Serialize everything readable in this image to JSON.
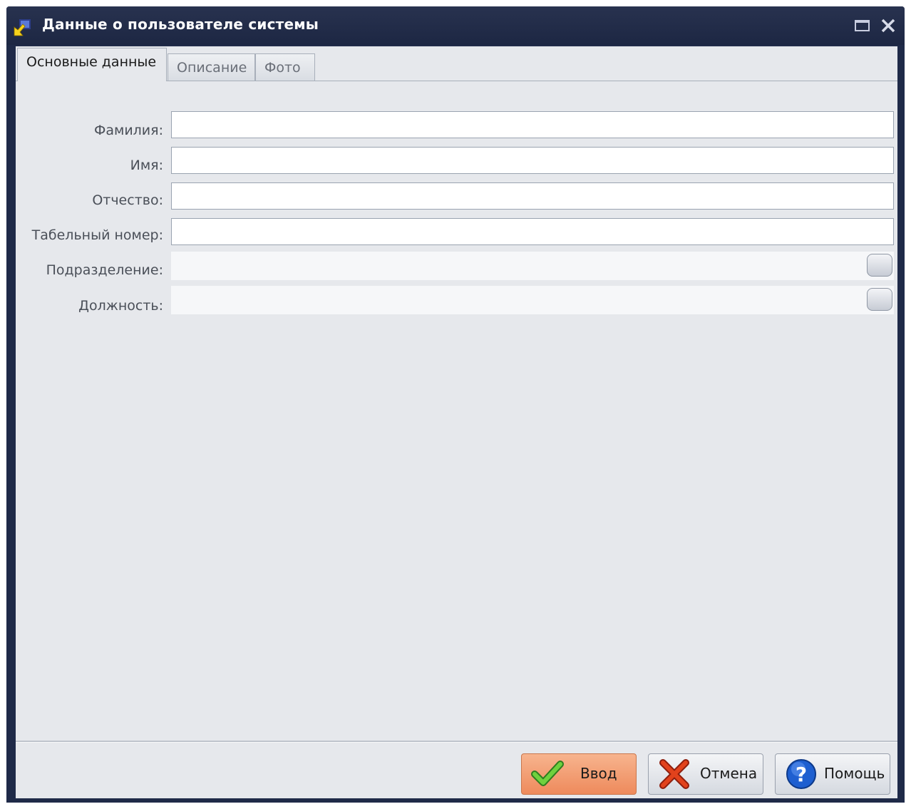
{
  "window": {
    "title": "Данные о пользователе системы"
  },
  "tabs": [
    {
      "label": "Основные данные",
      "active": true
    },
    {
      "label": "Описание",
      "active": false
    },
    {
      "label": "Фото",
      "active": false
    }
  ],
  "form": {
    "last_name": {
      "label": "Фамилия:",
      "value": ""
    },
    "first_name": {
      "label": "Имя:",
      "value": ""
    },
    "patronymic": {
      "label": "Отчество:",
      "value": ""
    },
    "personnel_number": {
      "label": "Табельный номер:",
      "value": ""
    },
    "department": {
      "label": "Подразделение:",
      "value": ""
    },
    "position": {
      "label": "Должность:",
      "value": ""
    }
  },
  "buttons": {
    "ok": "Ввод",
    "cancel": "Отмена",
    "help": "Помощь"
  },
  "colors": {
    "title_bar": "#1f2a48",
    "client_bg": "#e6e8ec",
    "ok_button": "#ee8a5c"
  },
  "icons": {
    "app": "user-arrow-icon",
    "maximize": "maximize-icon",
    "close": "close-icon",
    "ok": "checkmark-icon",
    "cancel": "x-mark-icon",
    "help": "question-icon"
  }
}
